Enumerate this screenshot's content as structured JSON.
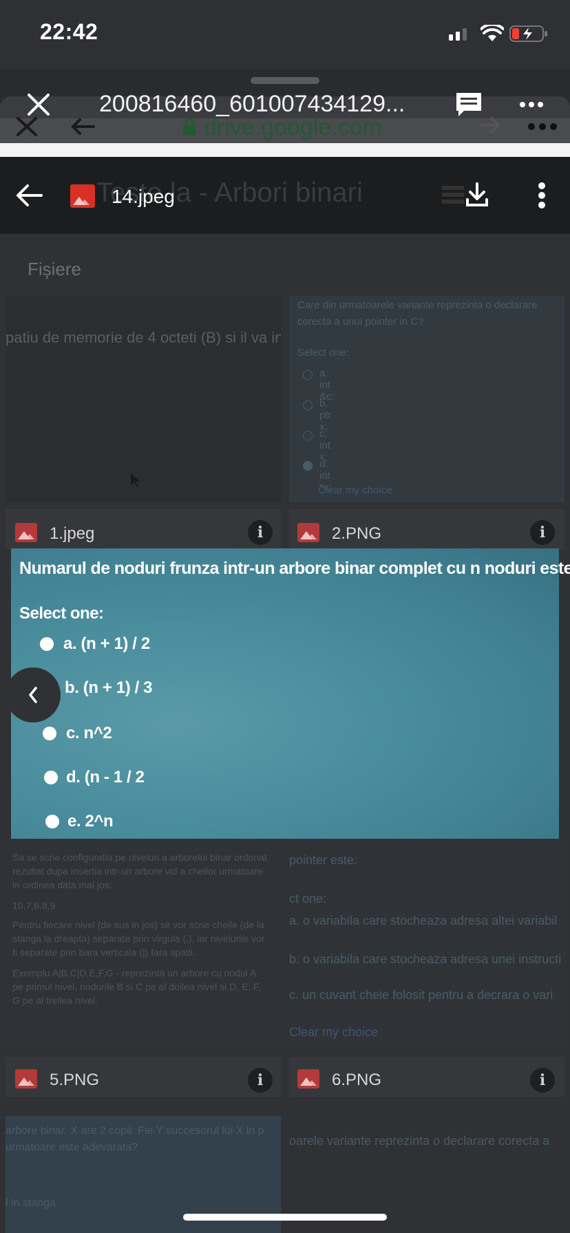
{
  "status_bar": {
    "time": "22:42"
  },
  "sheet": {
    "title": "200816460_601007434129...",
    "ghost_url": "drive.google.com"
  },
  "viewer": {
    "file_name": "14.jpeg",
    "ghost_folder": "Teste la - Arbori binari"
  },
  "drive": {
    "section": "Fișiere",
    "cards": [
      {
        "label": "1.jpeg"
      },
      {
        "label": "2.PNG"
      },
      {
        "label": "5.PNG"
      },
      {
        "label": "6.PNG"
      }
    ],
    "bg_snippets": {
      "card1_text": "patiu de memorie de 4 octeti (B) si il va in",
      "card2_question": "Care din urmatoarele variante reprezinta o declarare corecta a unui pointer in C?",
      "card2_select": "Select one:",
      "card2_opts": [
        "a. int &c;",
        "b. ptr x;",
        "c. int x;",
        "d. int *x;"
      ],
      "card2_clear": "Clear my choice",
      "card3_text": "Sa se scrie configuratia pe niveluri a arborelui binar ordonat rezultat dupa insertia intr-un arbore vid a cheilor urmatoare in ordinea data mai jos:",
      "card3_keys": "10,7,6,8,9",
      "card3_text2": "Pentru fiecare nivel (de sus in jos) se vor scrie cheile (de la stanga la dreapta) separate prin virgula (,), iar nivelurile vor fi separate prin bara verticala (|) fara spatii.",
      "card3_text3": "Exemplu A|B,C|D,E,F,G - reprezinta un arbore cu nodul A pe primul nivel, nodurile B si C pe al doilea nivel si D, E, F, G pe al treilea nivel.",
      "card4_q": "pointer este:",
      "card4_select": "ct one:",
      "card4_opts": [
        "a. o variabila care stocheaza adresa altei variabil",
        "b. o variabila care stocheaza adresa unei instructi",
        "c. un cuvant cheie folosit pentru a decrara o vari"
      ],
      "card4_clear": "Clear my choice",
      "card5_text": "arbore binar. X are 2 copii. Fie Y succesorul lui X in p urmatoare este adevarata?",
      "card5_text2": "l in stanga",
      "card6_text": "oarele variante reprezinta o declarare corecta a"
    }
  },
  "image": {
    "question": "Numarul de noduri frunza intr-un arbore binar complet cu n noduri este:",
    "select_label": "Select one:",
    "options": [
      {
        "text": "a. (n + 1)  / 2"
      },
      {
        "text": "b. (n + 1) / 3"
      },
      {
        "text": "c. n^2"
      },
      {
        "text": "d. (n - 1 / 2"
      },
      {
        "text": "e. 2^n"
      }
    ]
  }
}
